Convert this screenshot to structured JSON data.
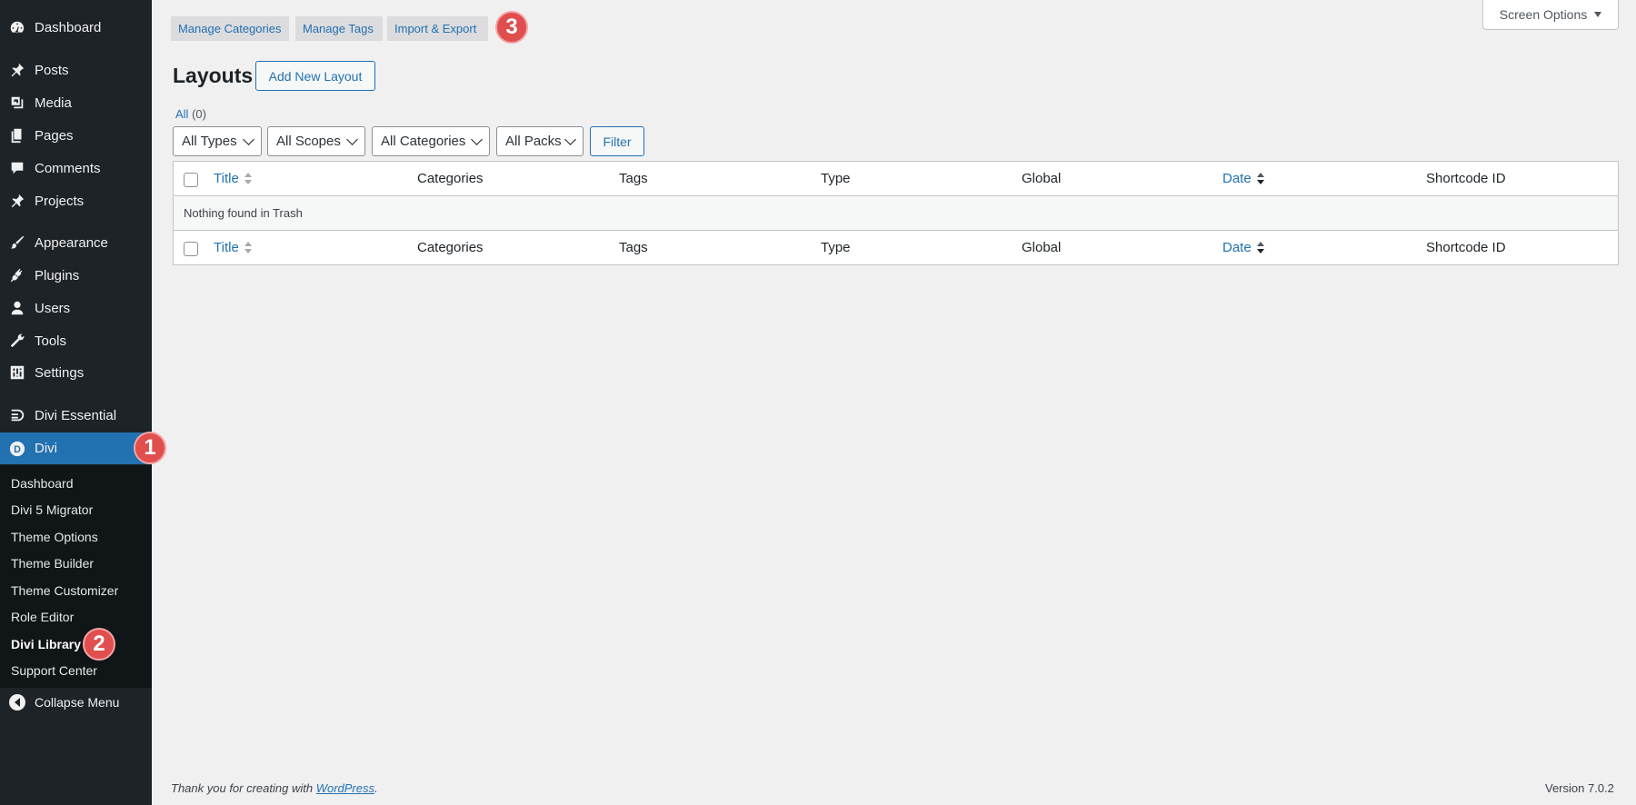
{
  "sidebar": {
    "items": [
      {
        "label": "Dashboard",
        "icon": "dashboard-icon"
      },
      {
        "label": "Posts",
        "icon": "pin-icon"
      },
      {
        "label": "Media",
        "icon": "media-icon"
      },
      {
        "label": "Pages",
        "icon": "pages-icon"
      },
      {
        "label": "Comments",
        "icon": "comment-icon"
      },
      {
        "label": "Projects",
        "icon": "pin-icon"
      },
      {
        "label": "Appearance",
        "icon": "brush-icon"
      },
      {
        "label": "Plugins",
        "icon": "plug-icon"
      },
      {
        "label": "Users",
        "icon": "user-icon"
      },
      {
        "label": "Tools",
        "icon": "wrench-icon"
      },
      {
        "label": "Settings",
        "icon": "settings-icon"
      },
      {
        "label": "Divi Essential",
        "icon": "divi-essential-icon"
      },
      {
        "label": "Divi",
        "icon": "divi-icon"
      }
    ],
    "submenu": [
      "Dashboard",
      "Divi 5 Migrator",
      "Theme Options",
      "Theme Builder",
      "Theme Customizer",
      "Role Editor",
      "Divi Library",
      "Support Center"
    ],
    "collapse_label": "Collapse Menu"
  },
  "badges": [
    "1",
    "2",
    "3"
  ],
  "top_tabs": [
    "Manage Categories",
    "Manage Tags",
    "Import & Export"
  ],
  "screen_options": "Screen Options",
  "page": {
    "title": "Layouts",
    "add_new": "Add New Layout",
    "view_all": "All",
    "view_count": "(0)"
  },
  "filters": {
    "types": "All Types",
    "scopes": "All Scopes",
    "categories": "All Categories",
    "packs": "All Packs",
    "filter_button": "Filter"
  },
  "table": {
    "columns": [
      "Title",
      "Categories",
      "Tags",
      "Type",
      "Global",
      "Date",
      "Shortcode ID"
    ],
    "empty_message": "Nothing found in Trash"
  },
  "footer": {
    "thanks_prefix": "Thank you for creating with ",
    "thanks_link": "WordPress",
    "thanks_suffix": ".",
    "version": "Version 7.0.2"
  },
  "colors": {
    "sidebar_bg": "#1d2327",
    "accent": "#2271b1",
    "badge": "#e04e4e"
  }
}
